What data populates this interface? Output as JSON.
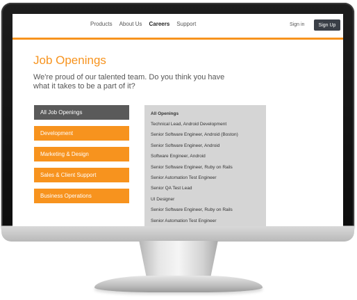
{
  "header": {
    "nav": [
      "Products",
      "About Us",
      "Careers",
      "Support"
    ],
    "active_nav": "Careers",
    "sign_in": "Sign in",
    "sign_up": "Sign Up"
  },
  "main": {
    "title": "Job Openings",
    "intro": "We're proud of our talented team. Do you think you have what it takes to be a part of it?"
  },
  "categories": [
    "All Job Openings",
    "Development",
    "Marketing & Design",
    "Sales & Client Support",
    "Business Operations"
  ],
  "selected_category": "All Job Openings",
  "openings": {
    "title": "All Openings",
    "jobs": [
      "Technical Lead, Android Development",
      "Senior Software Engineer, Android (Boston)",
      "Senior Software Engineer, Android",
      "Software Engineer, Android",
      "Senior Software Engineer, Ruby on Rails",
      "Senior Automation Test Engineer",
      "Senior QA Test Lead",
      "UI Designer",
      "Senior Software Engineer, Ruby on Rails",
      "Senior Automation Test Engineer"
    ]
  },
  "colors": {
    "accent": "#f7931e",
    "selected": "#5a5a5a",
    "panel": "#d5d5d5",
    "signup_bg": "#3a3f47"
  }
}
